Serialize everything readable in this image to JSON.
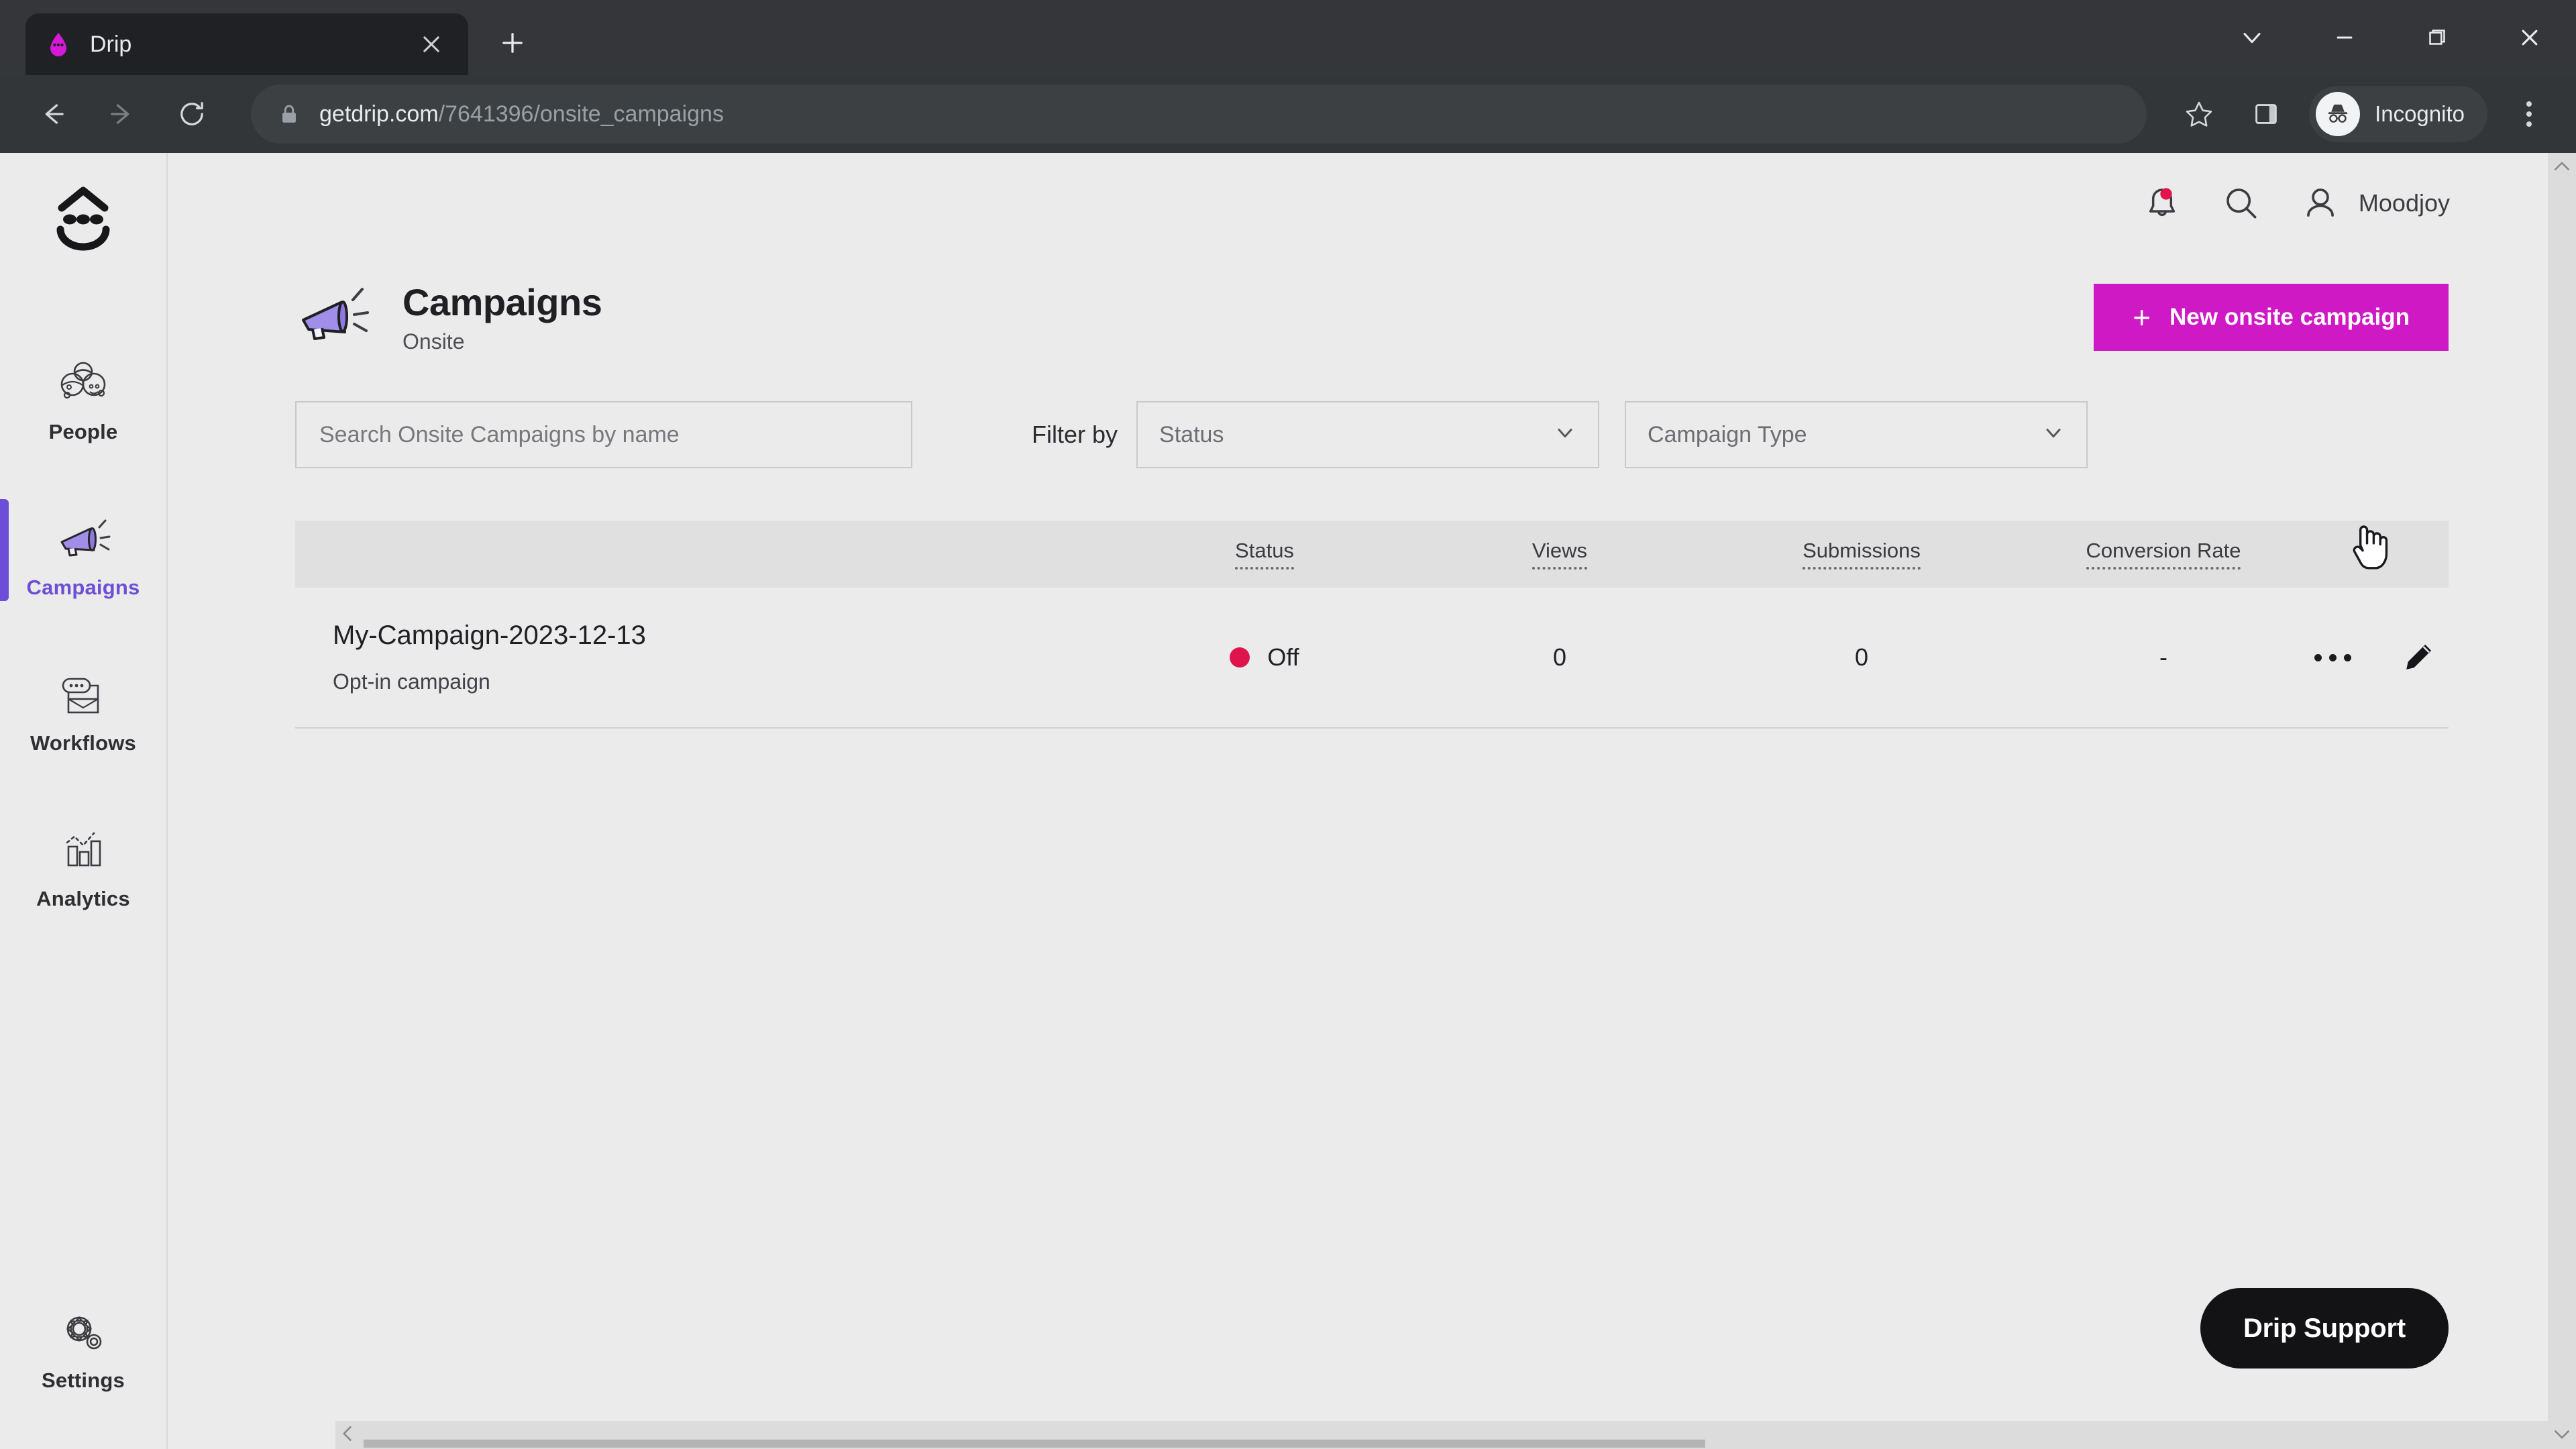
{
  "browser": {
    "tab": {
      "title": "Drip",
      "favicon_icon": "drip-logo-icon",
      "close_icon": "close-icon"
    },
    "new_tab_label": "+",
    "window_controls": {
      "tab_search_icon": "chevron-down-icon",
      "minimize_icon": "minimize-icon",
      "restore_icon": "restore-icon",
      "close_icon": "close-icon"
    },
    "nav": {
      "back_icon": "arrow-left-icon",
      "forward_icon": "arrow-right-icon",
      "reload_icon": "reload-icon"
    },
    "omnibox": {
      "lock_icon": "lock-icon",
      "url_domain": "getdrip.com",
      "url_path": "/7641396/onsite_campaigns"
    },
    "actions": {
      "bookmark_icon": "star-icon",
      "side_panel_icon": "side-panel-icon",
      "profile_label": "Incognito",
      "profile_icon": "incognito-icon",
      "menu_icon": "kebab-menu-icon"
    }
  },
  "sidebar": {
    "logo_icon": "drip-face-logo",
    "items": [
      {
        "label": "People",
        "icon": "people-icon",
        "active": false
      },
      {
        "label": "Campaigns",
        "icon": "megaphone-icon",
        "active": true
      },
      {
        "label": "Workflows",
        "icon": "workflow-icon",
        "active": false
      },
      {
        "label": "Analytics",
        "icon": "bar-chart-icon",
        "active": false
      }
    ],
    "settings": {
      "label": "Settings",
      "icon": "gear-icon"
    }
  },
  "topbar": {
    "notifications_icon": "bell-icon",
    "notifications_badge_color": "#e0144c",
    "search_icon": "search-icon",
    "account_icon": "person-icon",
    "account_name": "Moodjoy"
  },
  "page": {
    "icon": "megaphone-icon",
    "title": "Campaigns",
    "subtitle": "Onsite",
    "new_campaign_button": "New onsite campaign",
    "new_campaign_plus": "+",
    "accent_color": "#ce19c4"
  },
  "filters": {
    "search_placeholder": "Search Onsite Campaigns by name",
    "search_value": "",
    "filter_by_label": "Filter by",
    "status_select": {
      "value": "Status",
      "chevron_icon": "chevron-down-icon"
    },
    "type_select": {
      "value": "Campaign Type",
      "chevron_icon": "chevron-down-icon"
    }
  },
  "table": {
    "columns": [
      "",
      "Status",
      "Views",
      "Submissions",
      "Conversion Rate",
      ""
    ],
    "headers": {
      "status": "Status",
      "views": "Views",
      "submissions": "Submissions",
      "conversion_rate": "Conversion Rate"
    },
    "rows": [
      {
        "name": "My-Campaign-2023-12-13",
        "type": "Opt-in campaign",
        "status": "Off",
        "status_color": "#e0144c",
        "views": "0",
        "submissions": "0",
        "conversion_rate": "-",
        "more_icon": "more-horizontal-icon",
        "edit_icon": "pencil-icon"
      }
    ]
  },
  "support": {
    "label": "Drip Support"
  },
  "scrollbars": {
    "v_up_icon": "triangle-up-icon",
    "v_down_icon": "triangle-down-icon",
    "h_left_icon": "triangle-left-icon",
    "h_right_icon": "triangle-right-icon"
  }
}
